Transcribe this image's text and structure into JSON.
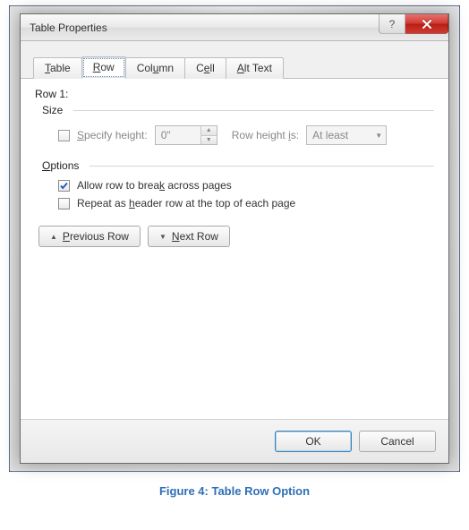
{
  "window": {
    "title": "Table Properties"
  },
  "tabs": [
    {
      "label": "Table",
      "hotkey": "T",
      "active": false
    },
    {
      "label": "Row",
      "hotkey": "R",
      "active": true
    },
    {
      "label": "Column",
      "hotkey": "u",
      "active": false
    },
    {
      "label": "Cell",
      "hotkey": "e",
      "active": false
    },
    {
      "label": "Alt Text",
      "hotkey": "A",
      "active": false
    }
  ],
  "row": {
    "header": "Row 1:",
    "size": {
      "legend": "Size",
      "specify_height_label": "Specify height:",
      "specify_height_hotkey": "S",
      "specify_height_checked": false,
      "height_value": "0\"",
      "row_height_is_label": "Row height is:",
      "row_height_is_hotkey": "i",
      "row_height_is_value": "At least"
    },
    "options": {
      "legend": "Options",
      "hotkey": "O",
      "allow_break_label": "Allow row to break across pages",
      "allow_break_hotkey": "k",
      "allow_break_checked": true,
      "repeat_header_label": "Repeat as header row at the top of each page",
      "repeat_header_hotkey": "h",
      "repeat_header_checked": false
    },
    "nav": {
      "prev_label": "Previous Row",
      "prev_hotkey": "P",
      "next_label": "Next Row",
      "next_hotkey": "N"
    }
  },
  "footer": {
    "ok": "OK",
    "cancel": "Cancel"
  },
  "caption": "Figure 4: Table Row Option"
}
